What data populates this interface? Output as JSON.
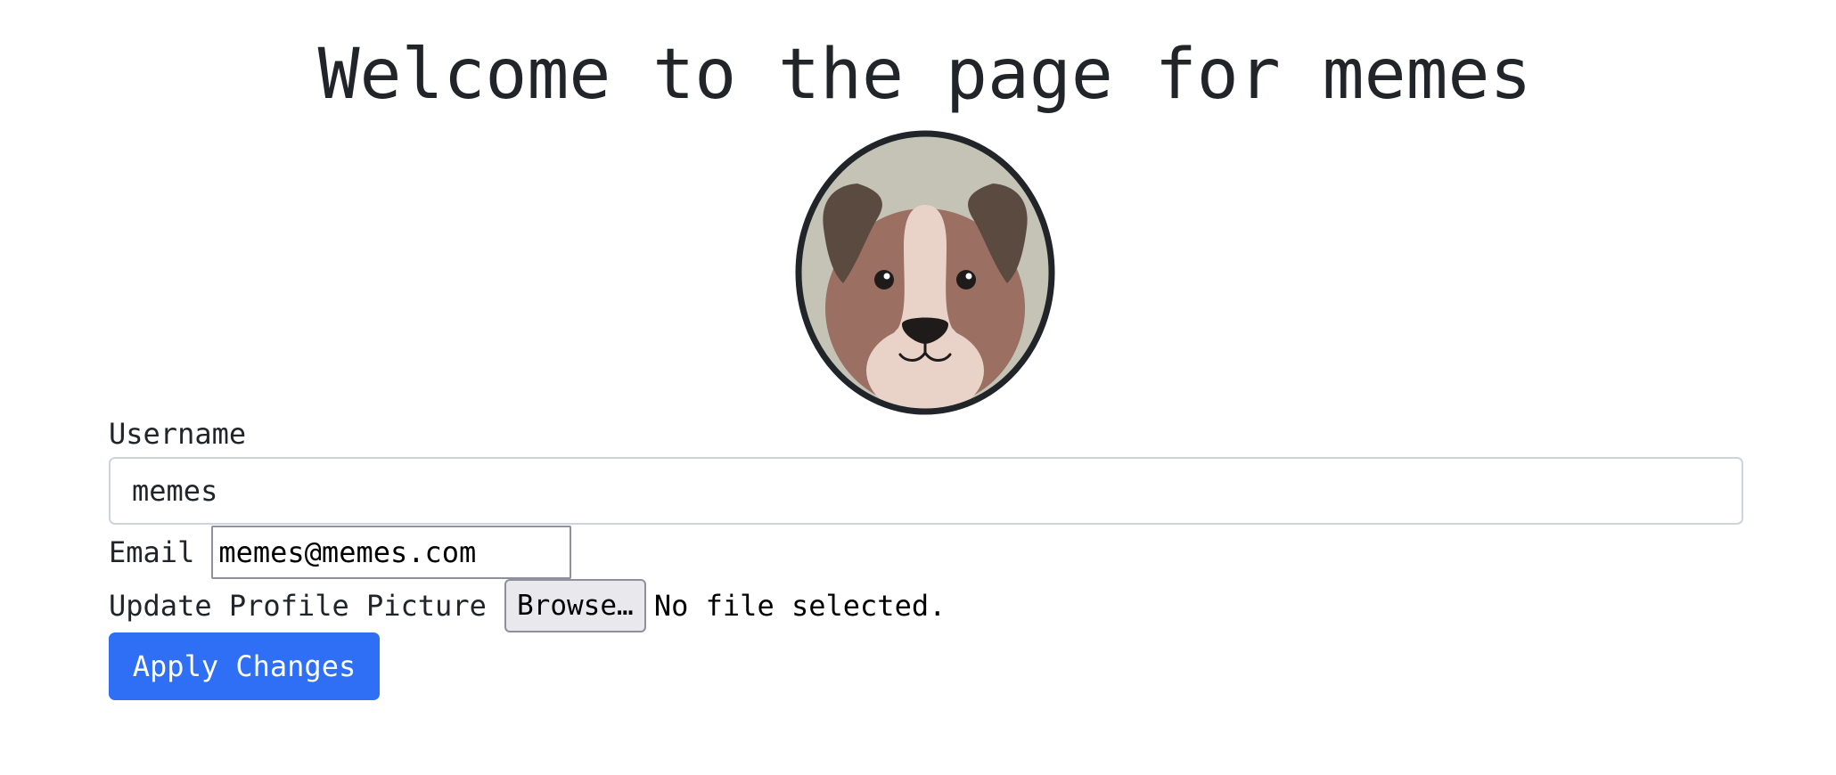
{
  "header": {
    "title": "Welcome to the page for memes"
  },
  "avatar": {
    "icon": "dog-avatar-image",
    "border_color": "#212529"
  },
  "form": {
    "username_label": "Username",
    "username_value": "memes",
    "email_label": "Email",
    "email_value": "memes@memes.com",
    "picture_label": "Update Profile Picture",
    "browse_label": "Browse…",
    "file_status": "No file selected.",
    "apply_label": "Apply Changes"
  },
  "colors": {
    "primary_button": "#2f6ff5",
    "text": "#212529"
  }
}
